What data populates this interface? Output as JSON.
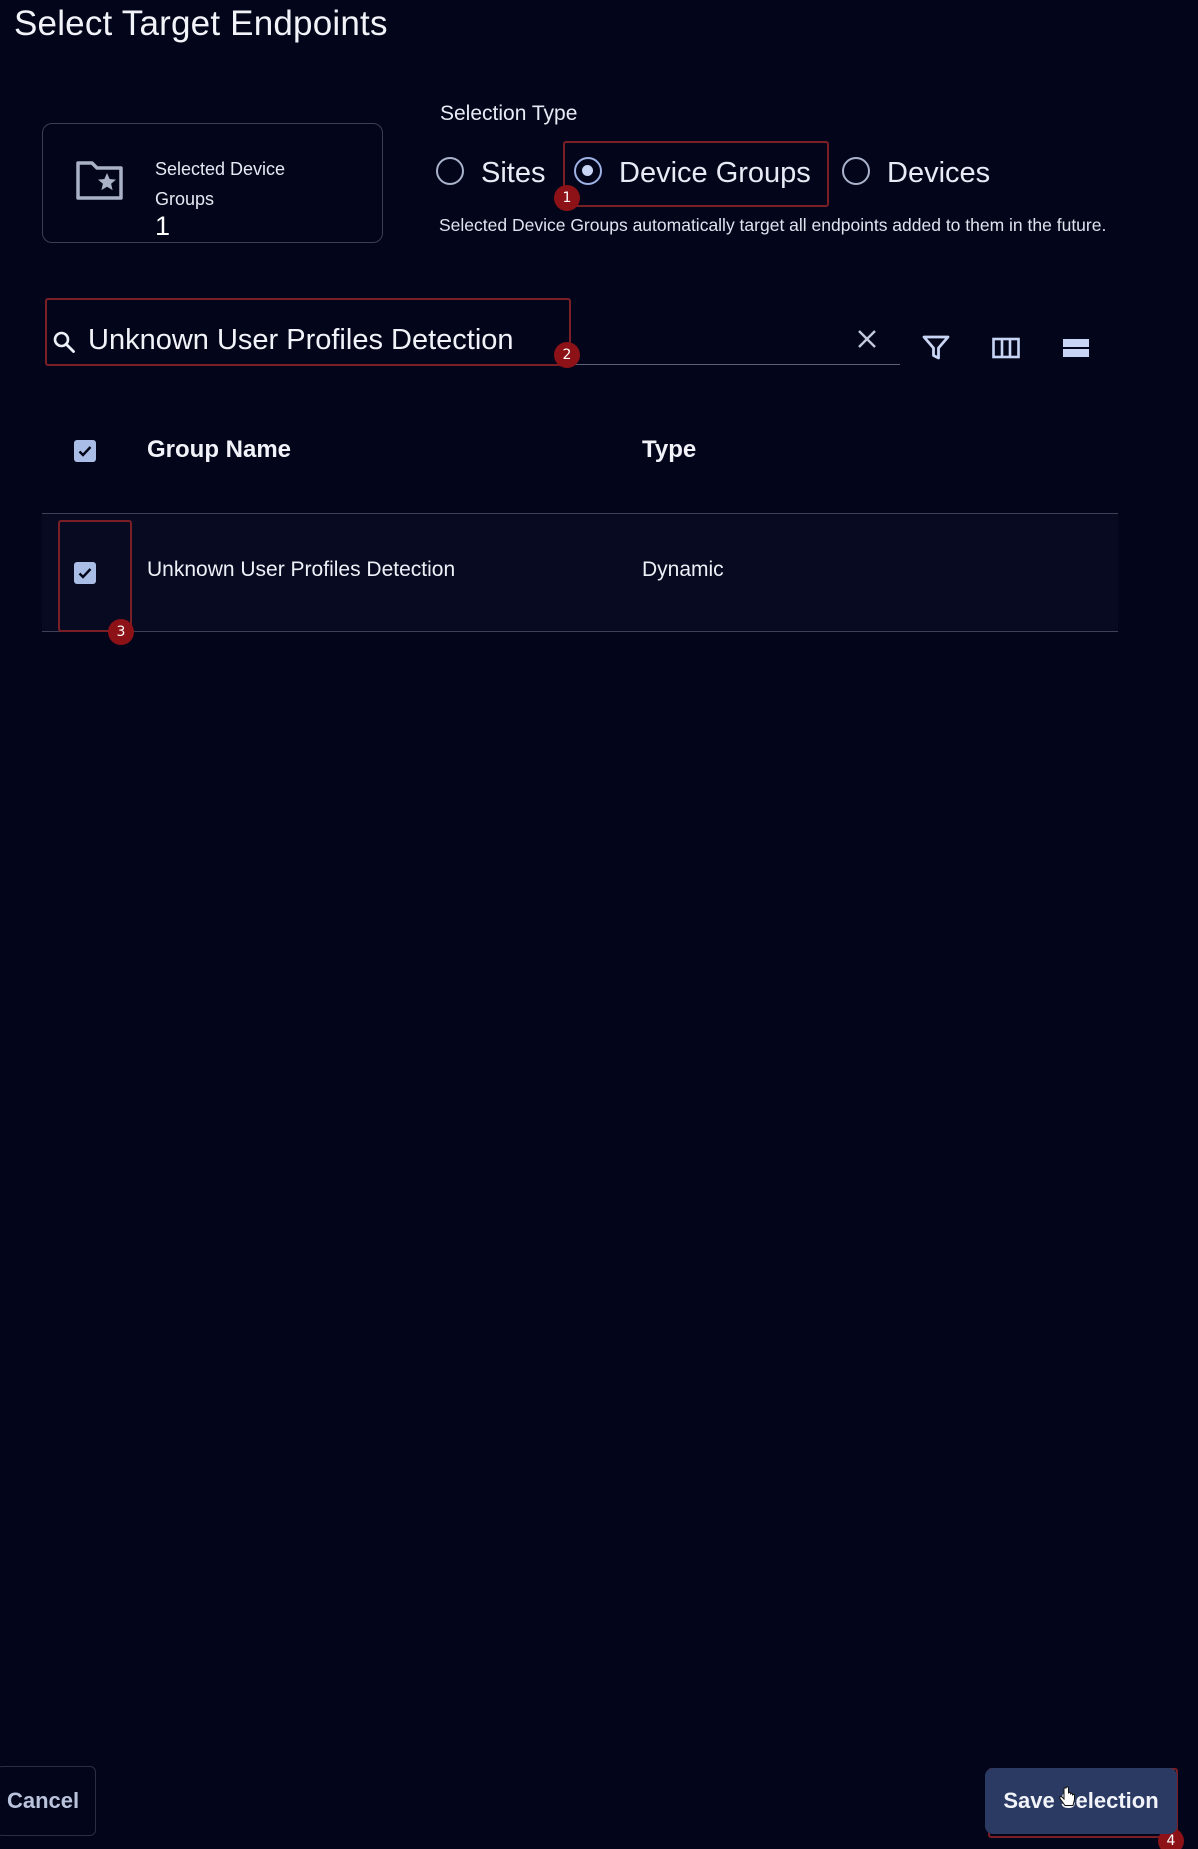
{
  "page": {
    "title": "Select Target Endpoints"
  },
  "summary": {
    "label": "Selected Device Groups",
    "count": "1",
    "icon": "folder-star-icon"
  },
  "selection_type": {
    "label": "Selection Type",
    "options": [
      {
        "label": "Sites",
        "checked": false
      },
      {
        "label": "Device Groups",
        "checked": true
      },
      {
        "label": "Devices",
        "checked": false
      }
    ],
    "helper": "Selected Device Groups automatically target all endpoints added to them in the future."
  },
  "search": {
    "value": "Unknown User Profiles Detection",
    "icons": [
      "search-icon",
      "clear-icon",
      "filter-icon",
      "columns-icon",
      "density-icon"
    ]
  },
  "table": {
    "columns": [
      "Group Name",
      "Type"
    ],
    "header_checked": true,
    "rows": [
      {
        "name": "Unknown User Profiles Detection",
        "type": "Dynamic",
        "checked": true
      }
    ]
  },
  "annotations": [
    "1",
    "2",
    "3",
    "4"
  ],
  "footer": {
    "cancel_label": "Cancel",
    "save_label": "Save Selection"
  },
  "colors": {
    "background": "#03061a",
    "accent": "#2b3a63",
    "annotation": "#8c1218",
    "checkbox": "#a9bde6"
  }
}
